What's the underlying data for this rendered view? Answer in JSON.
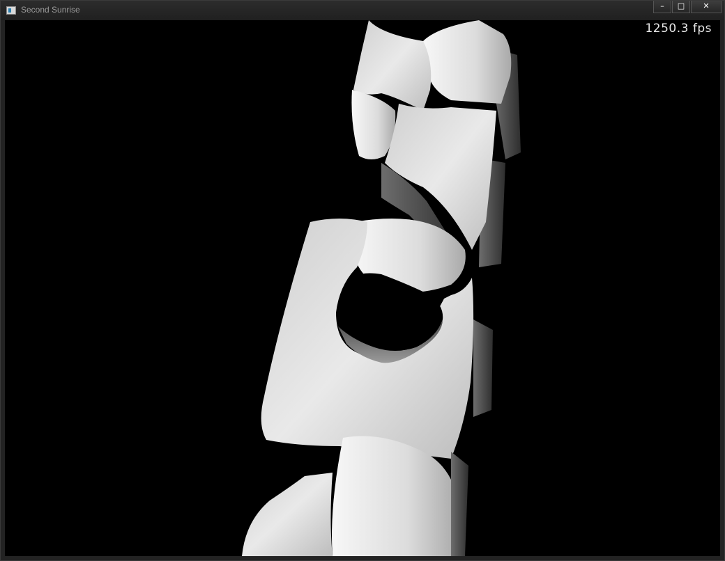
{
  "window": {
    "title": "Second Sunrise",
    "controls": {
      "minimize_glyph": "–",
      "maximize_glyph": "□",
      "close_glyph": "✕"
    },
    "icon": "app-window-icon"
  },
  "viewport": {
    "fps_text": "1250.3 fps",
    "background_color": "#000000",
    "mesh_color": "#d8d8d8"
  }
}
